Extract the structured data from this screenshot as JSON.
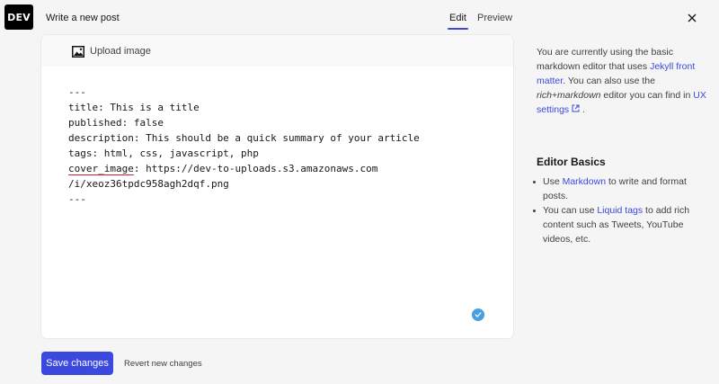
{
  "header": {
    "logo_text": "DEV",
    "title": "Write a new post",
    "tabs": [
      {
        "label": "Edit",
        "active": true
      },
      {
        "label": "Preview",
        "active": false
      }
    ],
    "close_icon": "close-icon"
  },
  "editor": {
    "upload_label": "Upload image",
    "upload_icon": "image-icon",
    "lines": [
      "---",
      "title: This is a title",
      "published: false",
      "description: This should be a quick summary of your article",
      "tags: html, css, javascript, php",
      "cover_image: https://dev-to-uploads.s3.amazonaws.com",
      "/i/xeoz36tpdc958agh2dqf.png",
      "---"
    ],
    "cover_key": "cover_image",
    "cover_rest": ": https://dev-to-uploads.s3.amazonaws.com",
    "status_icon": "check-circle-icon"
  },
  "sidebar": {
    "intro_1": "You are currently using the basic markdown editor that uses ",
    "intro_link_1": "Jekyll front matter",
    "intro_2": ". You can also use the ",
    "intro_em": "rich+markdown",
    "intro_3": " editor you can find in ",
    "intro_link_2": "UX settings",
    "intro_4": " .",
    "basics_heading": "Editor Basics",
    "basics": [
      {
        "pre": "Use ",
        "link": "Markdown",
        "post": " to write and format posts."
      },
      {
        "pre": "You can use ",
        "link": "Liquid tags",
        "post": " to add rich content such as Tweets, YouTube videos, etc."
      }
    ]
  },
  "footer": {
    "save_label": "Save changes",
    "revert_label": "Revert new changes"
  },
  "colors": {
    "accent": "#3b49df",
    "badge": "#4a9fe0",
    "squiggle": "#d21e1e"
  }
}
